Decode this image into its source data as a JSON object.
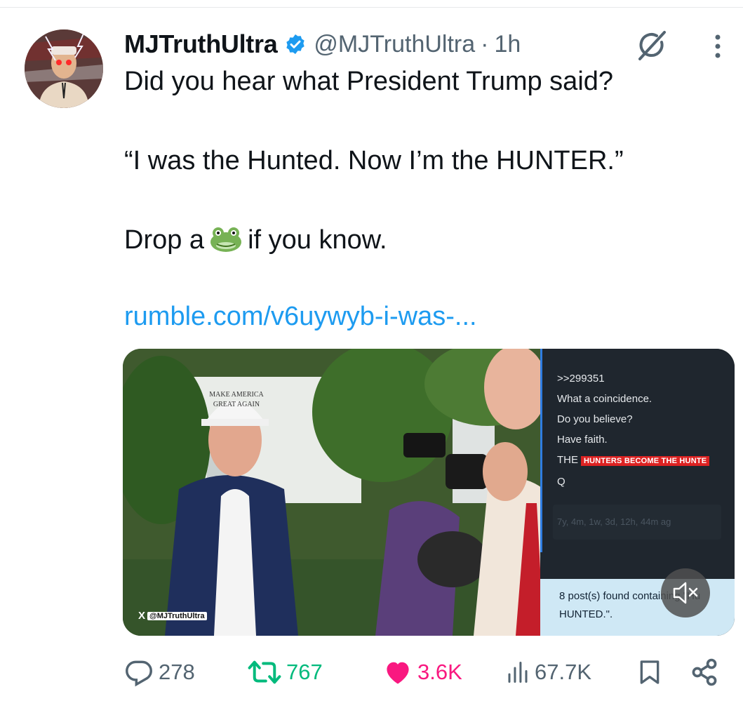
{
  "author": {
    "display_name": "MJTruthUltra",
    "handle": "@MJTruthUltra",
    "separator": "·",
    "time": "1h",
    "verified": true
  },
  "tweet": {
    "line1": "Did you hear what President Trump said?",
    "line2": "“I was the Hunted. Now I’m the HUNTER.”",
    "line3_before": "Drop a",
    "line3_emoji": "frog-face",
    "line3_after": "if you know.",
    "link": "rumble.com/v6uywyb-i-was-..."
  },
  "media": {
    "hat_text_1": "MAKE AMERICA",
    "hat_text_2": "GREAT AGAIN",
    "watermark_x": "X",
    "watermark_handle": "@MJTruthUltra",
    "q_panel": {
      "post_id": ">>299351",
      "line1": "What a coincidence.",
      "line2": "Do you believe?",
      "line3": "Have faith.",
      "line4_prefix": "THE",
      "line4_highlight": "HUNTERS BECOME THE HUNTE",
      "signature": "Q",
      "age": "7y, 4m, 1w, 3d, 12h, 44m ag",
      "found_line1": "8 post(s) found containing \"Hu",
      "found_line2": "HUNTED.\"."
    },
    "mute_icon": "speaker-muted-icon"
  },
  "actions": {
    "replies": "278",
    "reposts": "767",
    "likes": "3.6K",
    "views": "67.7K"
  },
  "colors": {
    "link": "#1d9bf0",
    "repost_active": "#00ba7c",
    "like_active": "#f91880",
    "muted_text": "#536471",
    "verified": "#1d9bf0"
  }
}
